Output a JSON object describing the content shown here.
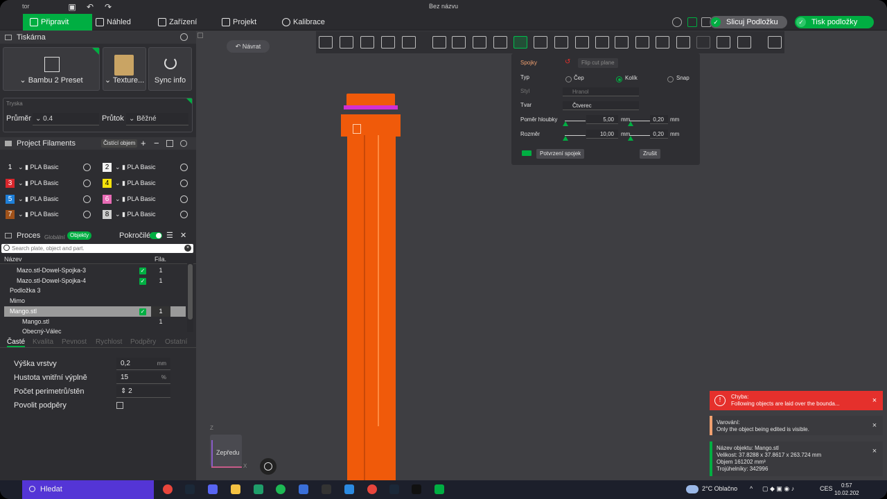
{
  "titlebar": {
    "partial_left": "tor",
    "title": "Bez názvu"
  },
  "menu": {
    "tabs": [
      {
        "label": "Připravit",
        "icon": "home-icon"
      },
      {
        "label": "Náhled",
        "icon": "cube-icon"
      },
      {
        "label": "Zařízení",
        "icon": "device-icon"
      },
      {
        "label": "Projekt",
        "icon": "document-icon"
      },
      {
        "label": "Kalibrace",
        "icon": "calibration-icon"
      }
    ],
    "slice_button": "Slicuj Podložku",
    "print_button": "Tisk podložky"
  },
  "printer": {
    "section_title": "Tiskárna",
    "printer_preset": "Bambu 2 Preset",
    "plate_type": "Texture...",
    "sync_label": "Sync info",
    "nozzle_label": "Tryska",
    "diameter_label": "Průměr",
    "diameter_value": "0.4",
    "flow_label": "Průtok",
    "flow_value": "Běžné"
  },
  "filaments": {
    "section_title": "Project Filaments",
    "clean_label": "Čistící objem",
    "items": [
      {
        "num": "1",
        "name": "PLA Basic",
        "color": "#2d2d31"
      },
      {
        "num": "2",
        "name": "PLA Basic",
        "color": "#f2f2f2"
      },
      {
        "num": "3",
        "name": "PLA Basic",
        "color": "#d8262c"
      },
      {
        "num": "4",
        "name": "PLA Basic",
        "color": "#f4e20c"
      },
      {
        "num": "5",
        "name": "PLA Basic",
        "color": "#1e7fd8"
      },
      {
        "num": "6",
        "name": "PLA Basic",
        "color": "#e86bb5"
      },
      {
        "num": "7",
        "name": "PLA Basic",
        "color": "#a0521a"
      },
      {
        "num": "8",
        "name": "PLA Basic",
        "color": "#cfcfcf"
      }
    ]
  },
  "process": {
    "section_title": "Proces",
    "global_label": "Globální",
    "objects_label": "Objekty",
    "advanced_label": "Pokročilé",
    "search_placeholder": "Search plate, object and part.",
    "col_name": "Název",
    "col_fila": "Fila.",
    "tree": [
      {
        "label": "Mazo.stl-Dowel-Spojka-3",
        "fila": "1",
        "checked": true
      },
      {
        "label": "Mazo.stl-Dowel-Spojka-4",
        "fila": "1",
        "checked": true
      },
      {
        "label": "Podložka 3",
        "fila": "",
        "checked": false
      },
      {
        "label": "Mimo",
        "fila": "",
        "checked": false
      },
      {
        "label": "Mango.stl",
        "fila": "1",
        "checked": true
      },
      {
        "label": "Mango.stl",
        "fila": "1",
        "checked": false
      },
      {
        "label": "Obecný-Válec",
        "fila": "",
        "checked": false
      }
    ],
    "tabs": [
      "Časté",
      "Kvalita",
      "Pevnost",
      "Rychlost",
      "Podpěry",
      "Ostatní"
    ],
    "params": [
      {
        "label": "Výška vrstvy",
        "value": "0,2",
        "unit": "mm"
      },
      {
        "label": "Hustota vnitřní výplně",
        "value": "15",
        "unit": "%"
      },
      {
        "label": "Počet perimetrů/stěn",
        "value": "2",
        "unit": ""
      },
      {
        "label": "Povolit podpěry",
        "value": "",
        "unit": ""
      }
    ]
  },
  "viewport": {
    "back_label": "Návrat",
    "view_label": "Zepředu",
    "axis_z": "Z",
    "axis_x": "X"
  },
  "cut_panel": {
    "connectors_label": "Spojky",
    "flip_label": "Flip cut plane",
    "type_label": "Typ",
    "type_options": [
      "Čep",
      "Kolík",
      "Snap"
    ],
    "type_selected": "Kolík",
    "style_label": "Styl",
    "style_value": "Hranol",
    "shape_label": "Tvar",
    "shape_value": "Čtverec",
    "depth_label": "Poměr hloubky",
    "depth_value": "5,00",
    "depth_tol": "0,20",
    "size_label": "Rozměr",
    "size_value": "10,00",
    "size_tol": "0,20",
    "unit": "mm",
    "confirm_label": "Potvrzení spojek",
    "cancel_label": "Zrušit"
  },
  "notifications": [
    {
      "kind": "error",
      "color": "#e5302c",
      "title": "Chyba:",
      "text": "Following objects are laid over the bounda..."
    },
    {
      "kind": "warning",
      "color": "#f0a070",
      "title": "Varování:",
      "text": "Only the object being edited is visible."
    },
    {
      "kind": "info",
      "color": "#00ae42",
      "lines": [
        "Název objektu: Mango.stl",
        "Velikost: 37.8288 x 37.8617 x 263.724 mm",
        "Objem 161202 mm³",
        "Trojúhelníky: 342996"
      ]
    }
  ],
  "taskbar": {
    "search_label": "Hledat",
    "weather": "2°C Oblačno",
    "lang": "CES",
    "time": "0:57",
    "date": "10.02.202"
  }
}
